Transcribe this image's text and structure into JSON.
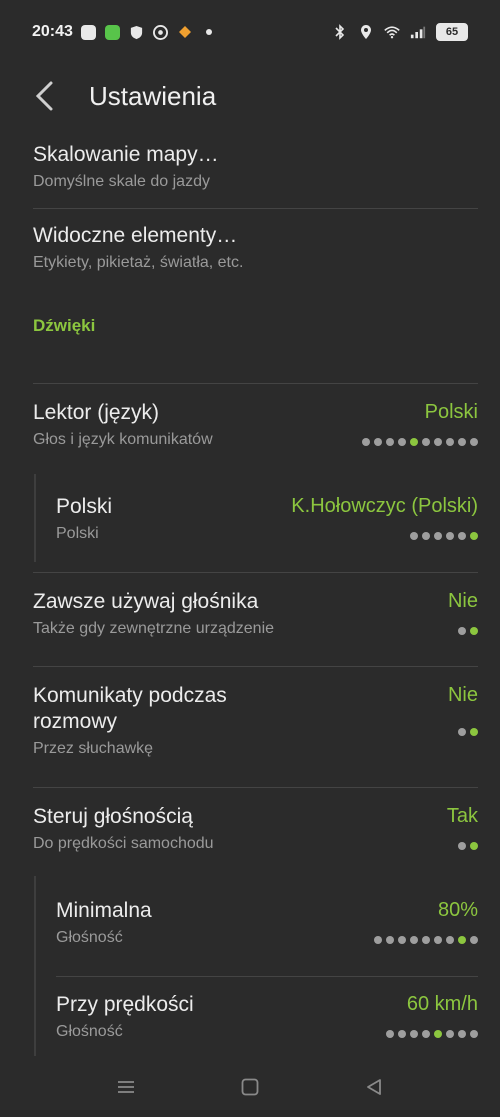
{
  "status": {
    "time": "20:43",
    "battery": "65"
  },
  "header": {
    "title": "Ustawienia"
  },
  "items": [
    {
      "title": "Skalowanie mapy…",
      "subtitle": "Domyślne skale do jazdy"
    },
    {
      "title": "Widoczne elementy…",
      "subtitle": "Etykiety, pikietaż, światła, etc."
    }
  ],
  "section": {
    "title": "Dźwięki"
  },
  "settings": {
    "lektor": {
      "title": "Lektor (język)",
      "subtitle": "Głos i język komunikatów",
      "value": "Polski",
      "dots_total": 10,
      "dots_selected": 5
    },
    "voice": {
      "title": "Polski",
      "subtitle": "Polski",
      "value": "K.Hołowczyc (Polski)",
      "dots_total": 6,
      "dots_selected": 6
    },
    "speaker": {
      "title": "Zawsze używaj głośnika",
      "subtitle": "Także gdy zewnętrzne urządzenie",
      "value": "Nie",
      "dots_total": 2,
      "dots_selected": 2
    },
    "calls": {
      "title_line1": "Komunikaty podczas",
      "title_line2": "rozmowy",
      "subtitle": "Przez słuchawkę",
      "value": "Nie",
      "dots_total": 2,
      "dots_selected": 2
    },
    "volume_control": {
      "title": "Steruj głośnością",
      "subtitle": "Do prędkości samochodu",
      "value": "Tak",
      "dots_total": 2,
      "dots_selected": 2
    },
    "minimal": {
      "title": "Minimalna",
      "subtitle": "Głośność",
      "value": "80%",
      "dots_total": 9,
      "dots_selected": 8
    },
    "speed": {
      "title": "Przy prędkości",
      "subtitle": "Głośność",
      "value": "60 km/h",
      "dots_total": 8,
      "dots_selected": 5
    }
  },
  "colors": {
    "accent": "#8cc63f",
    "background": "#2b2b2b"
  }
}
